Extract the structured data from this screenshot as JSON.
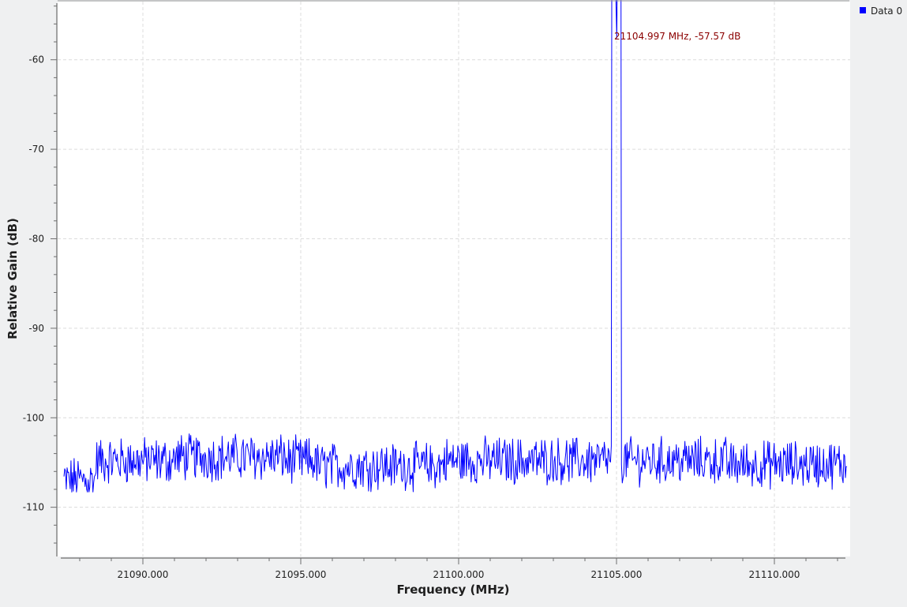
{
  "chart_data": {
    "type": "line",
    "xlabel": "Frequency (MHz)",
    "ylabel": "Relative Gain (dB)",
    "xlim": [
      21087.3,
      21112.4
    ],
    "ylim": [
      -115.5,
      -53.5
    ],
    "x_ticks": [
      21090,
      21095,
      21100,
      21105,
      21110
    ],
    "x_tick_labels": [
      "21090.000",
      "21095.000",
      "21100.000",
      "21105.000",
      "21110.000"
    ],
    "y_ticks": [
      -60,
      -70,
      -80,
      -90,
      -100,
      -110
    ],
    "y_tick_labels": [
      "-60",
      "-70",
      "-80",
      "-90",
      "-100",
      "-110"
    ],
    "grid": true,
    "legend_position": "top-right",
    "series": [
      {
        "name": "Data 0",
        "color": "#0000ff",
        "x_start": 21087.5,
        "x_end": 21112.3,
        "noise_floor_db": -104.8,
        "noise_range_db": [
          -108.3,
          -101.0
        ],
        "peak": {
          "x": 21104.997,
          "y": -57.57
        }
      }
    ],
    "annotations": [
      {
        "text": "21104.997 MHz, -57.57 dB",
        "x": 21104.997,
        "y": -57.57
      }
    ]
  },
  "colors": {
    "background": "#eff0f1",
    "plot_area": "#ffffff",
    "grid": "#dcdcdc",
    "series": "#0000ff",
    "marker_text": "#8b0000",
    "text": "#1e1e1e"
  }
}
